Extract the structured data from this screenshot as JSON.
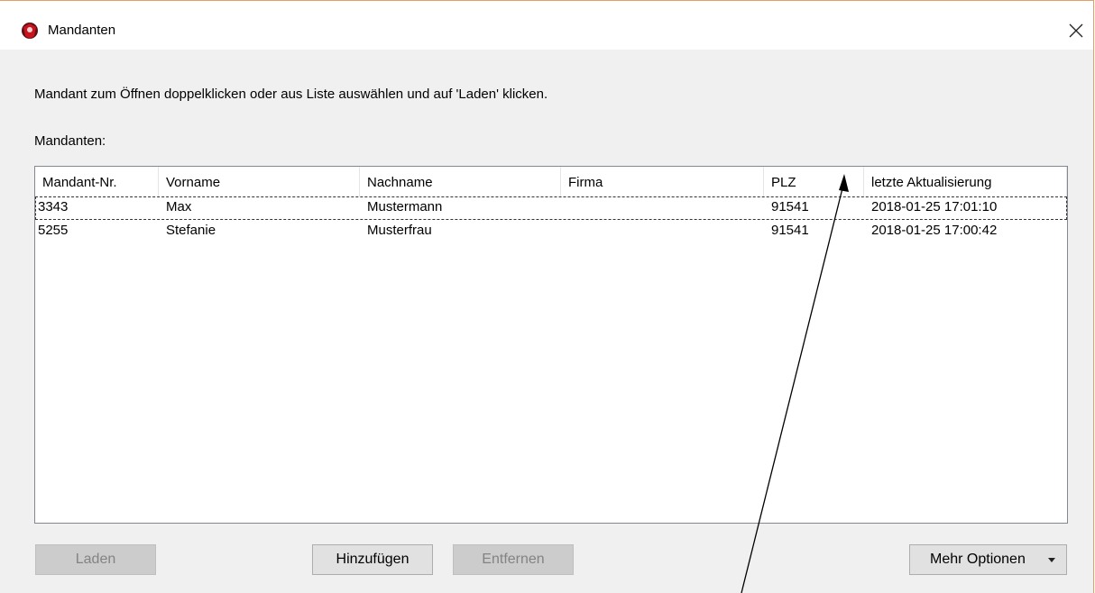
{
  "window": {
    "title": "Mandanten"
  },
  "instruction": "Mandant zum Öffnen doppelklicken oder aus Liste auswählen und auf 'Laden' klicken.",
  "list_label": "Mandanten:",
  "table": {
    "columns": [
      "Mandant-Nr.",
      "Vorname",
      "Nachname",
      "Firma",
      "PLZ",
      "letzte Aktualisierung"
    ],
    "rows": [
      [
        "3343",
        "Max",
        "Mustermann",
        "",
        "91541",
        "2018-01-25 17:01:10"
      ],
      [
        "5255",
        "Stefanie",
        "Musterfrau",
        "",
        "91541",
        "2018-01-25 17:00:42"
      ]
    ],
    "focused_row": 0
  },
  "buttons": {
    "load": "Laden",
    "add": "Hinzufügen",
    "remove": "Entfernen",
    "more": "Mehr Optionen"
  },
  "colors": {
    "window_border": "#e2a069",
    "disabled_text": "#838383",
    "icon_red": "#c8141e"
  },
  "icons": {
    "app": "mandanten-app-icon",
    "close": "close-icon",
    "dropdown": "chevron-down-icon"
  }
}
